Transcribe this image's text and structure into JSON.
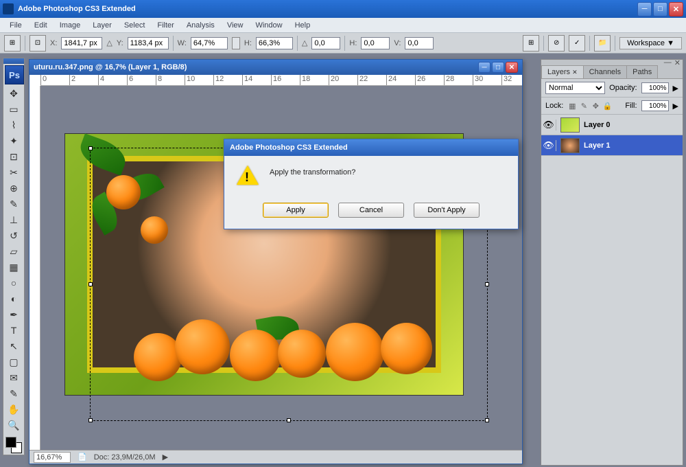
{
  "app": {
    "title": "Adobe Photoshop CS3 Extended"
  },
  "menu": [
    "File",
    "Edit",
    "Image",
    "Layer",
    "Select",
    "Filter",
    "Analysis",
    "View",
    "Window",
    "Help"
  ],
  "options": {
    "x_label": "X:",
    "x": "1841,7 px",
    "y_label": "Y:",
    "y": "1183,4 px",
    "w_label": "W:",
    "w": "64,7%",
    "h_label": "H:",
    "h": "66,3%",
    "a_label": "△",
    "a": "0,0",
    "hskew_label": "H:",
    "hskew": "0,0",
    "vskew_label": "V:",
    "vskew": "0,0",
    "workspace": "Workspace ▼"
  },
  "document": {
    "title": "uturu.ru.347.png @ 16,7% (Layer 1, RGB/8)",
    "zoom": "16,67%",
    "docinfo": "Doc: 23,9M/26,0M",
    "ruler_h": [
      "0",
      "2",
      "4",
      "6",
      "8",
      "10",
      "12",
      "14",
      "16",
      "18",
      "20",
      "22",
      "24",
      "26",
      "28",
      "30",
      "32"
    ]
  },
  "dialog": {
    "title": "Adobe Photoshop CS3 Extended",
    "message": "Apply the transformation?",
    "apply": "Apply",
    "cancel": "Cancel",
    "dont": "Don't Apply"
  },
  "panel": {
    "tabs": [
      "Layers",
      "Channels",
      "Paths"
    ],
    "blend": "Normal",
    "opacity_label": "Opacity:",
    "opacity": "100%",
    "lock_label": "Lock:",
    "fill_label": "Fill:",
    "fill": "100%",
    "layers": [
      {
        "name": "Layer 0"
      },
      {
        "name": "Layer 1"
      }
    ]
  },
  "ps_logo": "Ps"
}
